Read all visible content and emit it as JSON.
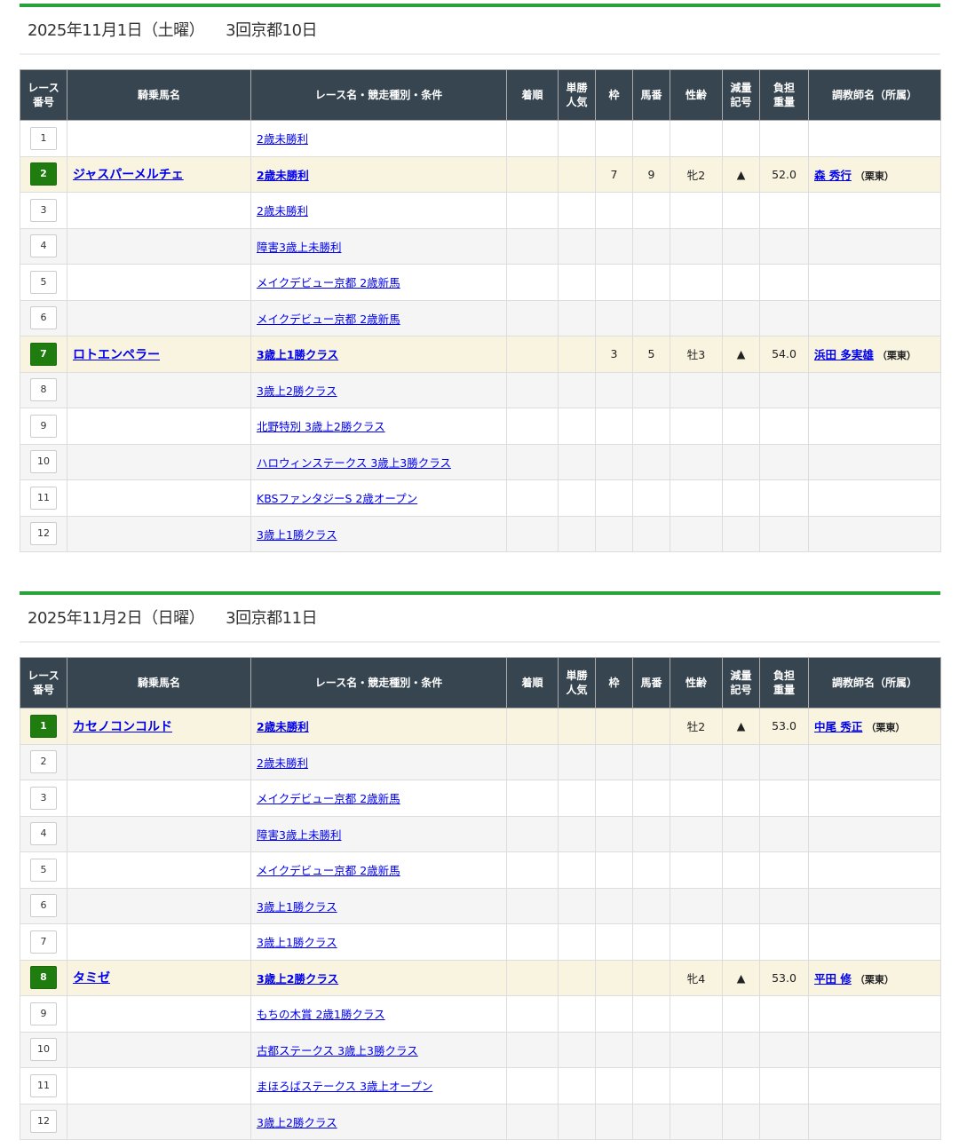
{
  "headers": [
    "レース番号",
    "騎乗馬名",
    "レース名・競走種別・条件",
    "着順",
    "単勝人気",
    "枠",
    "馬番",
    "性齢",
    "減量記号",
    "負担重量",
    "調教師名（所属）"
  ],
  "days": [
    {
      "date": "2025年11月1日（土曜）",
      "meeting": "3回京都10日",
      "races": [
        {
          "no": "1",
          "horse": "",
          "race": "2歳未勝利"
        },
        {
          "no": "2",
          "horse": "ジャスパーメルチェ",
          "race": "2歳未勝利",
          "waku": "7",
          "umaban": "9",
          "sexage": "牝2",
          "mark": "▲",
          "weight": "52.0",
          "trainer": "森 秀行",
          "affil": "（栗東）"
        },
        {
          "no": "3",
          "horse": "",
          "race": "2歳未勝利"
        },
        {
          "no": "4",
          "horse": "",
          "race": "障害3歳上未勝利"
        },
        {
          "no": "5",
          "horse": "",
          "race": "メイクデビュー京都 2歳新馬"
        },
        {
          "no": "6",
          "horse": "",
          "race": "メイクデビュー京都 2歳新馬"
        },
        {
          "no": "7",
          "horse": "ロトエンペラー",
          "race": "3歳上1勝クラス",
          "waku": "3",
          "umaban": "5",
          "sexage": "牡3",
          "mark": "▲",
          "weight": "54.0",
          "trainer": "浜田 多実雄",
          "affil": "（栗東）"
        },
        {
          "no": "8",
          "horse": "",
          "race": "3歳上2勝クラス"
        },
        {
          "no": "9",
          "horse": "",
          "race": "北野特別 3歳上2勝クラス"
        },
        {
          "no": "10",
          "horse": "",
          "race": "ハロウィンステークス 3歳上3勝クラス"
        },
        {
          "no": "11",
          "horse": "",
          "race": "KBSファンタジーS 2歳オープン"
        },
        {
          "no": "12",
          "horse": "",
          "race": "3歳上1勝クラス"
        }
      ]
    },
    {
      "date": "2025年11月2日（日曜）",
      "meeting": "3回京都11日",
      "races": [
        {
          "no": "1",
          "horse": "カセノコンコルド",
          "race": "2歳未勝利",
          "sexage": "牡2",
          "mark": "▲",
          "weight": "53.0",
          "trainer": "中尾 秀正",
          "affil": "（栗東）"
        },
        {
          "no": "2",
          "horse": "",
          "race": "2歳未勝利"
        },
        {
          "no": "3",
          "horse": "",
          "race": "メイクデビュー京都 2歳新馬"
        },
        {
          "no": "4",
          "horse": "",
          "race": "障害3歳上未勝利"
        },
        {
          "no": "5",
          "horse": "",
          "race": "メイクデビュー京都 2歳新馬"
        },
        {
          "no": "6",
          "horse": "",
          "race": "3歳上1勝クラス"
        },
        {
          "no": "7",
          "horse": "",
          "race": "3歳上1勝クラス"
        },
        {
          "no": "8",
          "horse": "タミゼ",
          "race": "3歳上2勝クラス",
          "sexage": "牝4",
          "mark": "▲",
          "weight": "53.0",
          "trainer": "平田 修",
          "affil": "（栗東）"
        },
        {
          "no": "9",
          "horse": "",
          "race": "もちの木賞 2歳1勝クラス"
        },
        {
          "no": "10",
          "horse": "",
          "race": "古都ステークス 3歳上3勝クラス"
        },
        {
          "no": "11",
          "horse": "",
          "race": "まほろばステークス 3歳上オープン"
        },
        {
          "no": "12",
          "horse": "",
          "race": "3歳上2勝クラス"
        }
      ]
    }
  ]
}
